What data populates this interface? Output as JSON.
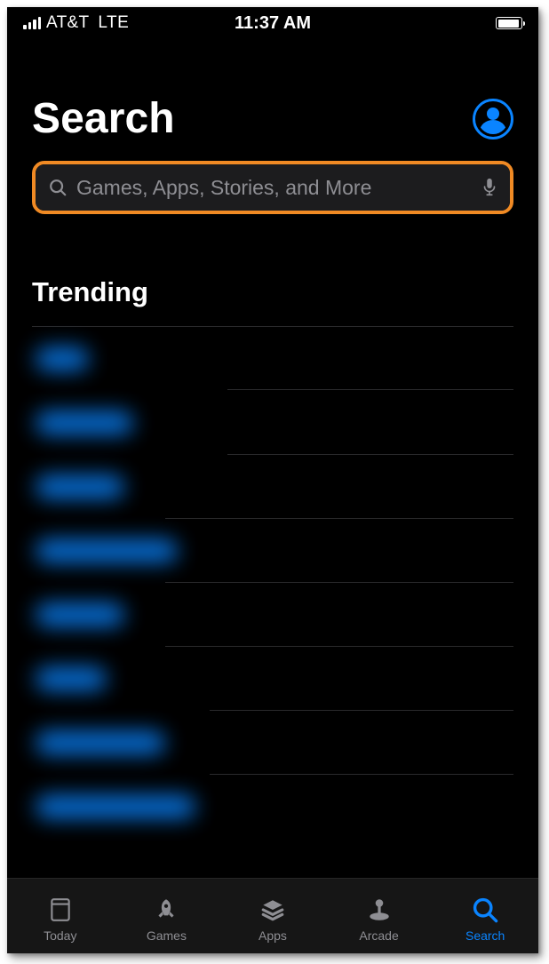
{
  "status_bar": {
    "carrier": "AT&T",
    "network": "LTE",
    "time": "11:37 AM"
  },
  "header": {
    "title": "Search"
  },
  "search": {
    "placeholder": "Games, Apps, Stories, and More"
  },
  "trending": {
    "heading": "Trending"
  },
  "tabs": {
    "items": [
      {
        "label": "Today"
      },
      {
        "label": "Games"
      },
      {
        "label": "Apps"
      },
      {
        "label": "Arcade"
      },
      {
        "label": "Search"
      }
    ],
    "active_index": 4
  },
  "colors": {
    "accent": "#0a84ff",
    "highlight_border": "#f08a24",
    "background": "#000000",
    "tabbar": "#161616",
    "secondary_text": "#8e8e93"
  }
}
